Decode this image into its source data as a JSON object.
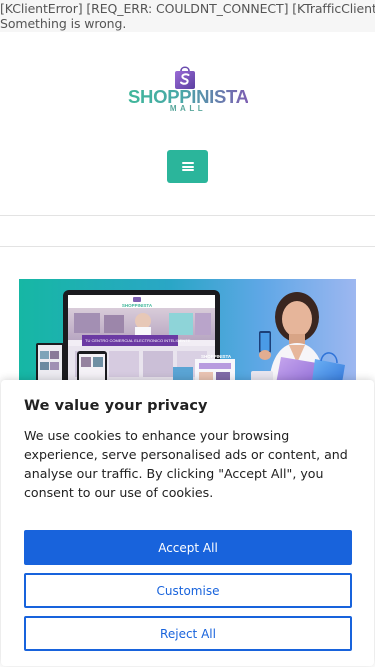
{
  "error": {
    "line1": "[KClientError] [REQ_ERR: COULDNT_CONNECT] [KTrafficClient]",
    "line2": "Something is wrong."
  },
  "logo": {
    "brand": "SHOPPINISTA",
    "sub": "MALL",
    "colors": {
      "teal": "#3fb79a",
      "purple": "#7d5fb2"
    }
  },
  "header": {
    "menu_icon": "hamburger-icon",
    "menu_color": "#2bb59b"
  },
  "hero": {
    "laptop_brand": "SHOPPINISTA",
    "laptop_banner": "TU CENTRO COMERCIAL ELECTRONICO INTELIGENTE",
    "phone_brand": "SHOPPINISTA"
  },
  "cookie_banner": {
    "title": "We value your privacy",
    "text": "We use cookies to enhance your browsing experience, serve personalised ads or content, and analyse our traffic. By clicking \"Accept All\", you consent to our use of cookies.",
    "accept_label": "Accept All",
    "customise_label": "Customise",
    "reject_label": "Reject All",
    "accent": "#1863dc"
  }
}
